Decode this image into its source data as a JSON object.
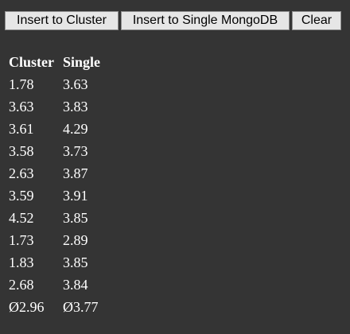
{
  "toolbar": {
    "insert_cluster_label": "Insert to Cluster",
    "insert_single_label": "Insert to Single MongoDB",
    "clear_label": "Clear"
  },
  "results": {
    "headers": [
      "Cluster",
      "Single"
    ],
    "rows": [
      [
        "1.78",
        "3.63"
      ],
      [
        "3.63",
        "3.83"
      ],
      [
        "3.61",
        "4.29"
      ],
      [
        "3.58",
        "3.73"
      ],
      [
        "2.63",
        "3.87"
      ],
      [
        "3.59",
        "3.91"
      ],
      [
        "4.52",
        "3.85"
      ],
      [
        "1.73",
        "2.89"
      ],
      [
        "1.83",
        "3.85"
      ],
      [
        "2.68",
        "3.84"
      ]
    ],
    "average": [
      "Ø2.96",
      "Ø3.77"
    ]
  },
  "colors": {
    "background": "#343434",
    "text": "#ffffff",
    "button_background": "#e6e6e6",
    "button_border": "#8f8f8f"
  }
}
